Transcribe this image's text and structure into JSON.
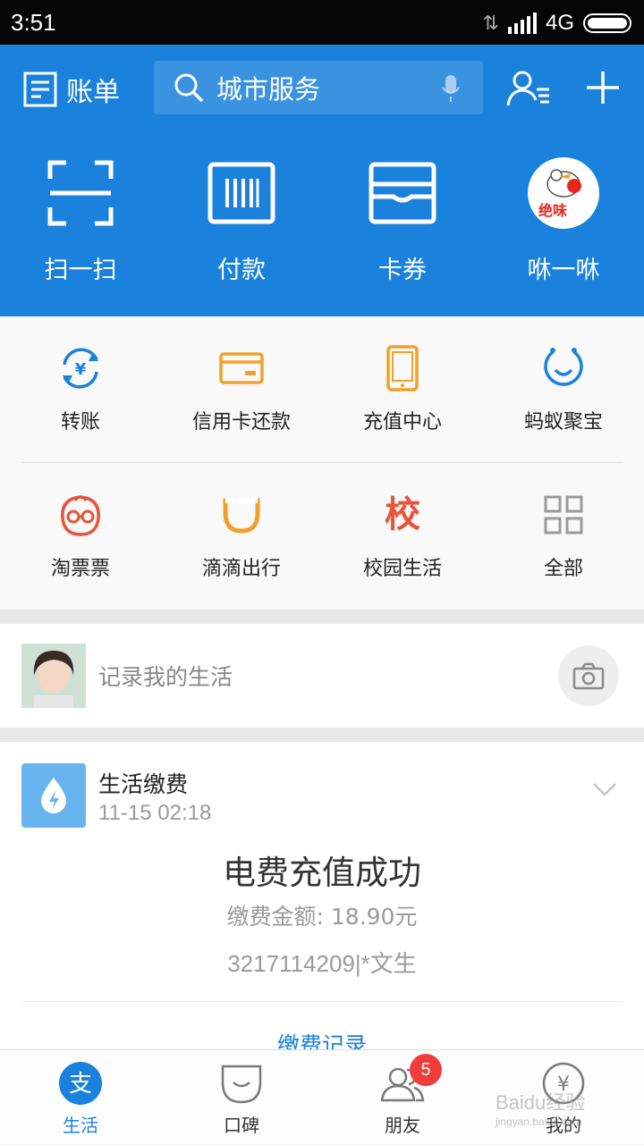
{
  "status_bar": {
    "time": "3:51",
    "network": "4G"
  },
  "header": {
    "bill_label": "账单",
    "search_placeholder": "城市服务"
  },
  "quick_actions": [
    {
      "label": "扫一扫",
      "icon": "scan-icon"
    },
    {
      "label": "付款",
      "icon": "barcode-pay-icon"
    },
    {
      "label": "卡券",
      "icon": "card-coupon-icon"
    },
    {
      "label": "咻一咻",
      "icon": "juewei-logo"
    }
  ],
  "services": [
    {
      "label": "转账",
      "icon": "transfer-icon",
      "color": "#1a82dc"
    },
    {
      "label": "信用卡还款",
      "icon": "credit-card-icon",
      "color": "#f1a128"
    },
    {
      "label": "充值中心",
      "icon": "phone-recharge-icon",
      "color": "#f1a128"
    },
    {
      "label": "蚂蚁聚宝",
      "icon": "ant-fortune-icon",
      "color": "#1a82dc"
    },
    {
      "label": "淘票票",
      "icon": "taopiaopiao-icon",
      "color": "#e8533b"
    },
    {
      "label": "滴滴出行",
      "icon": "didi-icon",
      "color": "#f1a128"
    },
    {
      "label": "校园生活",
      "icon": "campus-icon",
      "color": "#e8533b",
      "glyph": "校"
    },
    {
      "label": "全部",
      "icon": "grid-icon",
      "color": "#9a9a9a"
    }
  ],
  "record": {
    "text": "记录我的生活"
  },
  "card": {
    "title": "生活缴费",
    "time": "11-15 02:18",
    "main": "电费充值成功",
    "amount": "缴费金额: 18.90元",
    "account": "3217114209|*文生",
    "link": "缴费记录"
  },
  "tabbar": [
    {
      "label": "生活",
      "icon": "life-tab-icon",
      "active": true
    },
    {
      "label": "口碑",
      "icon": "koubei-tab-icon",
      "active": false
    },
    {
      "label": "朋友",
      "icon": "friends-tab-icon",
      "active": false,
      "badge": "5"
    },
    {
      "label": "我的",
      "icon": "mine-tab-icon",
      "active": false
    }
  ],
  "colors": {
    "primary": "#1a82dc",
    "orange": "#f1a128",
    "red": "#e8533b",
    "badge": "#f23b3b"
  },
  "watermark": {
    "text": "Baidu经验",
    "subtext": "jingyan.baidu.com"
  }
}
